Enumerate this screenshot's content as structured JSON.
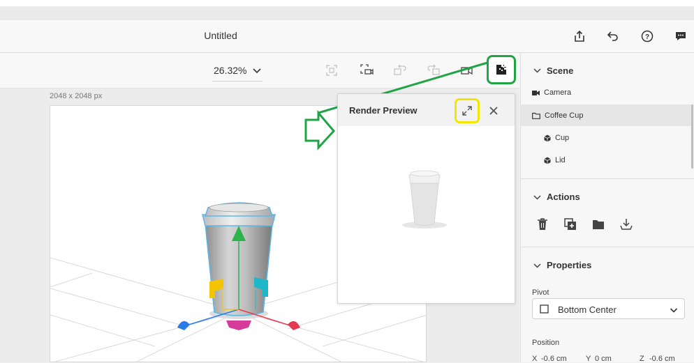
{
  "header": {
    "title": "Untitled",
    "icons": [
      "share-icon",
      "undo-icon",
      "help-icon",
      "feedback-icon"
    ]
  },
  "toolbar": {
    "zoom": "26.32%",
    "tools": [
      "frame-icon",
      "camera-fit-icon",
      "rotate-left-icon",
      "rotate-right-icon",
      "camera-icon",
      "render-preview-icon"
    ]
  },
  "canvas": {
    "size_label": "2048 x 2048 px"
  },
  "render_preview": {
    "title": "Render Preview"
  },
  "scene": {
    "title": "Scene",
    "items": [
      {
        "label": "Camera",
        "icon": "camera-icon"
      },
      {
        "label": "Coffee Cup",
        "icon": "folder-icon"
      },
      {
        "label": "Cup",
        "icon": "model-icon"
      },
      {
        "label": "Lid",
        "icon": "model-icon"
      }
    ]
  },
  "actions": {
    "title": "Actions",
    "icons": [
      "delete-icon",
      "duplicate-icon",
      "group-icon",
      "export-icon"
    ]
  },
  "properties": {
    "title": "Properties",
    "pivot_label": "Pivot",
    "pivot_value": "Bottom Center",
    "position_label": "Position",
    "x_label": "X",
    "x_value": "-0.6 cm",
    "y_label": "Y",
    "y_value": "0 cm",
    "z_label": "Z",
    "z_value": "-0.6 cm"
  },
  "colors": {
    "annotation_green": "#20a445",
    "annotation_yellow": "#f2e600",
    "gizmo_green": "#2eb24b",
    "gizmo_red": "#e5394f",
    "gizmo_blue": "#2a7ae8",
    "gizmo_yellow": "#f5c400",
    "gizmo_cyan": "#1fb8c8",
    "gizmo_magenta": "#d63b9a"
  }
}
